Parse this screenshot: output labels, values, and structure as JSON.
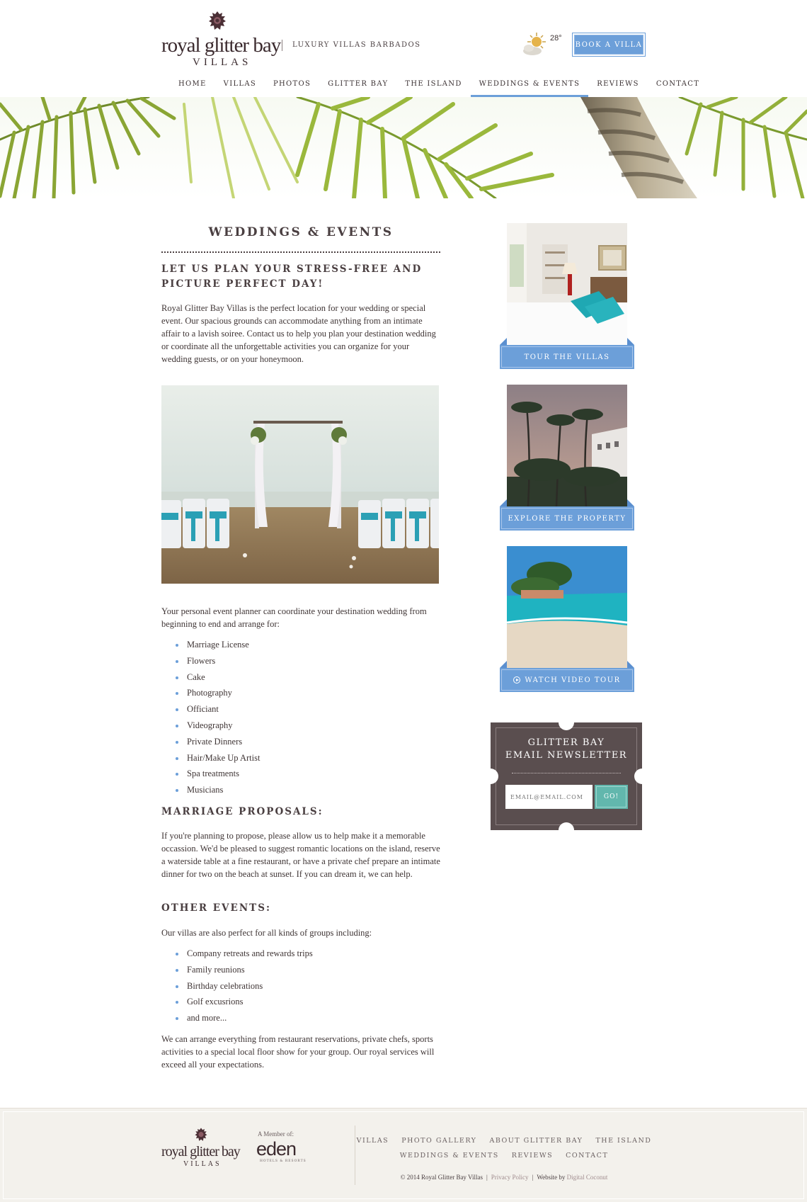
{
  "brand": {
    "wordmark": "royal glitter bay",
    "sub": "VILLAS",
    "tagline": "LUXURY VILLAS BARBADOS"
  },
  "weather": {
    "temp": "28°",
    "icon": "sun-cloud-icon"
  },
  "header": {
    "book_label": "BOOK A VILLA"
  },
  "nav": {
    "items": [
      "HOME",
      "VILLAS",
      "PHOTOS",
      "GLITTER BAY",
      "THE ISLAND",
      "WEDDINGS & EVENTS",
      "REVIEWS",
      "CONTACT"
    ],
    "active": "WEDDINGS & EVENTS"
  },
  "main": {
    "title": "WEDDINGS & EVENTS",
    "intro_heading": "LET US PLAN YOUR STRESS-FREE AND PICTURE PERFECT DAY!",
    "intro_text": "Royal Glitter Bay Villas is the perfect location for your wedding or special event. Our spacious grounds can accommodate anything from an intimate affair to a lavish soiree. Contact us to help you plan your destination wedding or coordinate all the unforgettable activities you can organize for your wedding guests, or on your honeymoon.",
    "planner_text": "Your personal event planner can coordinate your destination wedding from beginning to end and arrange for:",
    "services": [
      "Marriage License",
      "Flowers",
      "Cake",
      "Photography",
      "Officiant",
      "Videography",
      "Private Dinners",
      "Hair/Make Up Artist",
      "Spa treatments",
      "Musicians"
    ],
    "proposals_heading": "MARRIAGE PROPOSALS:",
    "proposals_text": "If you're planning to propose, please allow us to help make it a memorable occassion. We'd be pleased to suggest romantic locations on the island, reserve a waterside table at a fine restaurant, or have a private chef prepare an intimate dinner for two on the beach at sunset. If you can dream it, we can help.",
    "other_heading": "OTHER EVENTS:",
    "other_text": "Our villas are also perfect for all kinds of groups including:",
    "groups": [
      "Company retreats and rewards trips",
      "Family reunions",
      "Birthday celebrations",
      "Golf excusrions",
      "and more..."
    ],
    "closing_text": "We can arrange everything from restaurant reservations, private chefs, sports activities to a special local floor show for your group. Our royal services will exceed all your expectations."
  },
  "sidebar": {
    "tour_label": "TOUR THE VILLAS",
    "explore_label": "EXPLORE THE PROPERTY",
    "video_label": "WATCH VIDEO TOUR",
    "newsletter": {
      "title_line1": "GLITTER BAY",
      "title_line2": "EMAIL NEWSLETTER",
      "placeholder": "EMAIL@EMAIL.COM",
      "button": "GO!"
    }
  },
  "footer": {
    "member_label": "A Member of:",
    "partner_name": "eden",
    "partner_sub": "HOTELS & RESORTS",
    "links_row1": [
      "VILLAS",
      "PHOTO GALLERY",
      "ABOUT GLITTER BAY",
      "THE ISLAND"
    ],
    "links_row2": [
      "WEDDINGS & EVENTS",
      "REVIEWS",
      "CONTACT"
    ],
    "copyright": "© 2014 Royal Glitter Bay Villas",
    "privacy": "Privacy Policy",
    "website_by": "Website by",
    "agency": "Digital Coconut"
  },
  "colors": {
    "accent_blue": "#6c9fd9",
    "brand_brown": "#5a4e4f",
    "go_teal": "#62b7ad",
    "footer_bg": "#f3f1ec"
  }
}
